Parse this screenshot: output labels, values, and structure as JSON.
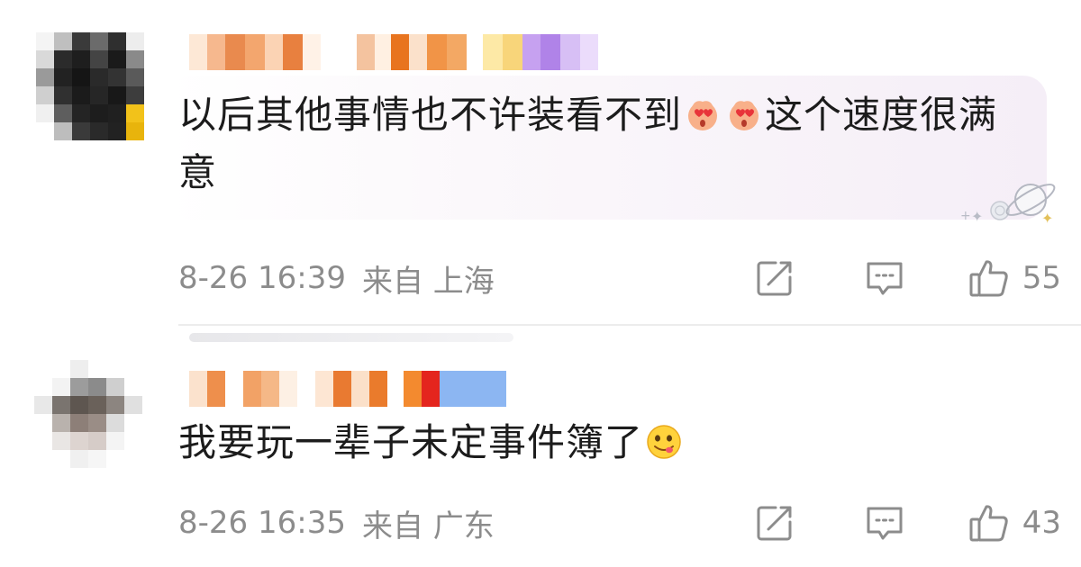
{
  "comments": [
    {
      "text_part1": "以后其他事情也不许装看不到",
      "text_part2": "这个速度很满意",
      "emojis": [
        "love-eyes-emoji",
        "love-eyes-emoji"
      ],
      "time": "8-26 16:39",
      "location": "来自 上海",
      "likes": "55"
    },
    {
      "text": "我要玩一辈子未定事件簿了",
      "emojis": [
        "yummy-face-emoji"
      ],
      "time": "8-26 16:35",
      "location": "来自 广东",
      "likes": "43"
    }
  ],
  "icons": [
    "share-icon",
    "reply-comment-icon",
    "thumbs-up-icon",
    "planet-decoration-icon"
  ],
  "colors": {
    "meta_text": "#8c8c8c",
    "body_text": "#1c1c1c",
    "bubble_tint": "#f5eef7",
    "divider": "#ececec"
  }
}
